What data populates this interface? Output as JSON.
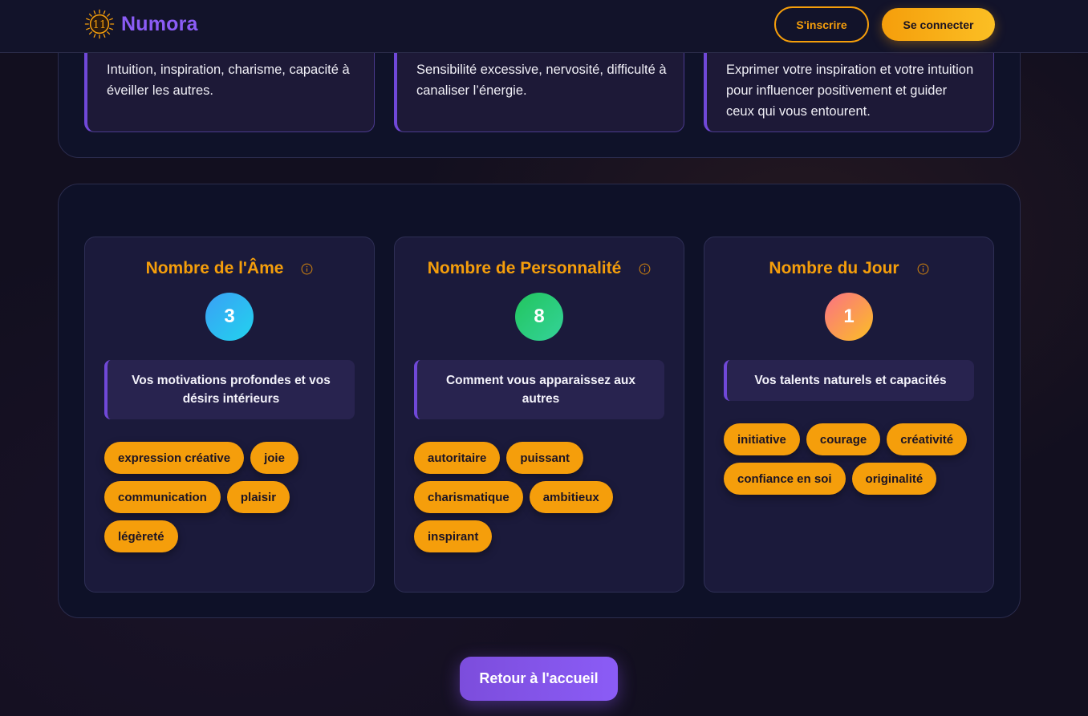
{
  "header": {
    "logo_icon": "numerology-sun-11-icon",
    "logo_number": "11",
    "brand": "Numora",
    "signup_label": "S'inscrire",
    "login_label": "Se connecter"
  },
  "traits": [
    {
      "text": "Intuition, inspiration, charisme, capacité à éveiller les autres."
    },
    {
      "text": "Sensibilité excessive, nervosité, difficulté à canaliser l’énergie."
    },
    {
      "text": "Exprimer votre inspiration et votre intuition pour influencer positivement et guider ceux qui vous entourent."
    }
  ],
  "numbers": [
    {
      "title": "Nombre de l'Âme",
      "value": "3",
      "description": "Vos motivations profondes et vos désirs intérieurs",
      "tags": [
        "expression créative",
        "joie",
        "communication",
        "plaisir",
        "légèreté"
      ],
      "icon": "info-icon"
    },
    {
      "title": "Nombre de Personnalité",
      "value": "8",
      "description": "Comment vous apparaissez aux autres",
      "tags": [
        "autoritaire",
        "puissant",
        "charismatique",
        "ambitieux",
        "inspirant"
      ],
      "icon": "info-icon"
    },
    {
      "title": "Nombre du Jour",
      "value": "1",
      "description": "Vos talents naturels et capacités",
      "tags": [
        "initiative",
        "courage",
        "créativité",
        "confiance en soi",
        "originalité"
      ],
      "icon": "info-icon"
    }
  ],
  "footer": {
    "back_label": "Retour à l'accueil"
  },
  "colors": {
    "accent_purple": "#8b5cf6",
    "accent_orange": "#f59e0b",
    "background": "#120f1f"
  }
}
